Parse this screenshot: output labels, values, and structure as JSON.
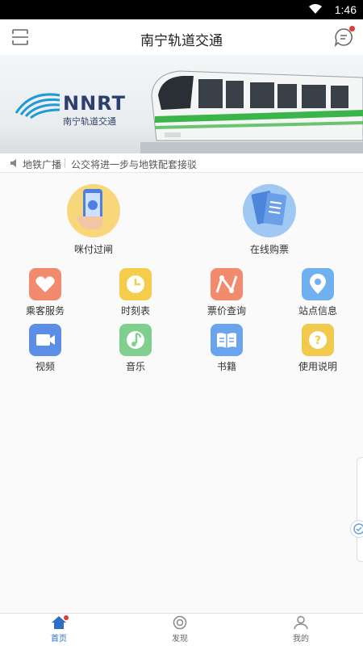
{
  "status_bar": {
    "time": "1:46"
  },
  "header": {
    "title": "南宁轨道交通"
  },
  "banner": {
    "brand": "NNRT",
    "brand_cn": "南宁轨道交通"
  },
  "notice": {
    "label": "地铁广播",
    "text": "公交将进一步与地铁配套接驳"
  },
  "big_items": [
    {
      "label": "咪付过闸",
      "icon": "phone-gate-icon",
      "color": "#f7d77a"
    },
    {
      "label": "在线购票",
      "icon": "ticket-icon",
      "color": "#9fc8f3"
    }
  ],
  "grid_items": [
    {
      "label": "乘客服务",
      "icon": "heart-icon",
      "color": "#f28a6e"
    },
    {
      "label": "时刻表",
      "icon": "clock-icon",
      "color": "#f6cd4b"
    },
    {
      "label": "票价查询",
      "icon": "route-icon",
      "color": "#f28a6e"
    },
    {
      "label": "站点信息",
      "icon": "location-icon",
      "color": "#6fb0ef"
    },
    {
      "label": "视频",
      "icon": "video-icon",
      "color": "#5c8ee6"
    },
    {
      "label": "音乐",
      "icon": "music-icon",
      "color": "#7fcf8e"
    },
    {
      "label": "书籍",
      "icon": "book-icon",
      "color": "#6aa3ee"
    },
    {
      "label": "使用说明",
      "icon": "help-icon",
      "color": "#f1c94c"
    }
  ],
  "tabbar": [
    {
      "label": "首页",
      "icon": "home-icon",
      "active": true
    },
    {
      "label": "发现",
      "icon": "discover-icon",
      "active": false
    },
    {
      "label": "我的",
      "icon": "profile-icon",
      "active": false
    }
  ],
  "colors": {
    "accent": "#2f6ec6",
    "badge": "#e53935"
  }
}
